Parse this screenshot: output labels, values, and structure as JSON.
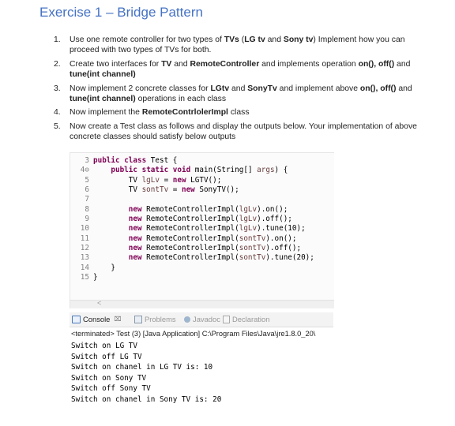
{
  "title": "Exercise 1 – Bridge Pattern",
  "tasks": [
    {
      "num": "1.",
      "parts": [
        {
          "t": "Use one remote controller for two types of "
        },
        {
          "t": "TVs",
          "b": true
        },
        {
          "t": " ("
        },
        {
          "t": "LG tv",
          "b": true
        },
        {
          "t": " and "
        },
        {
          "t": "Sony tv",
          "b": true
        },
        {
          "t": ") Implement how you can proceed with two types of TVs for both."
        }
      ]
    },
    {
      "num": "2.",
      "parts": [
        {
          "t": "Create two interfaces for "
        },
        {
          "t": "TV",
          "b": true
        },
        {
          "t": " and "
        },
        {
          "t": "RemoteController",
          "b": true
        },
        {
          "t": " and implements operation "
        },
        {
          "t": "on(), off()",
          "b": true
        },
        {
          "t": " and "
        },
        {
          "t": "tune(int channel)",
          "b": true
        }
      ]
    },
    {
      "num": "3.",
      "parts": [
        {
          "t": "Now implement 2 concrete classes for "
        },
        {
          "t": "LGtv",
          "b": true
        },
        {
          "t": " and "
        },
        {
          "t": "SonyTv",
          "b": true
        },
        {
          "t": " and implement above "
        },
        {
          "t": "on(), off()",
          "b": true
        },
        {
          "t": " and "
        },
        {
          "t": "tune(int channel)",
          "b": true
        },
        {
          "t": " operations in each class"
        }
      ]
    },
    {
      "num": "4.",
      "parts": [
        {
          "t": "Now implement the "
        },
        {
          "t": "RemoteContrlolerImpl",
          "b": true
        },
        {
          "t": " class"
        }
      ]
    },
    {
      "num": "5.",
      "parts": [
        {
          "t": "Now create a Test class as follows and display the outputs below. Your implementation of above concrete classes should satisfy below outputs"
        }
      ]
    }
  ],
  "code": {
    "lines": [
      {
        "n": "3",
        "segs": [
          {
            "t": "public",
            "k": "kw"
          },
          {
            "t": " "
          },
          {
            "t": "class",
            "k": "kw"
          },
          {
            "t": " Test {"
          }
        ]
      },
      {
        "n": "4⊖",
        "segs": [
          {
            "t": "    "
          },
          {
            "t": "public",
            "k": "kw"
          },
          {
            "t": " "
          },
          {
            "t": "static",
            "k": "kw"
          },
          {
            "t": " "
          },
          {
            "t": "void",
            "k": "kw"
          },
          {
            "t": " main(String[] "
          },
          {
            "t": "args",
            "k": "fld"
          },
          {
            "t": ") {"
          }
        ]
      },
      {
        "n": "5",
        "segs": [
          {
            "t": "        TV "
          },
          {
            "t": "lgLv",
            "k": "fld"
          },
          {
            "t": " = "
          },
          {
            "t": "new",
            "k": "kw"
          },
          {
            "t": " LGTV();"
          }
        ]
      },
      {
        "n": "6",
        "segs": [
          {
            "t": "        TV "
          },
          {
            "t": "sontTv",
            "k": "fld"
          },
          {
            "t": " = "
          },
          {
            "t": "new",
            "k": "kw"
          },
          {
            "t": " SonyTV();"
          }
        ]
      },
      {
        "n": "7",
        "segs": []
      },
      {
        "n": "8",
        "segs": [
          {
            "t": "        "
          },
          {
            "t": "new",
            "k": "kw"
          },
          {
            "t": " RemoteControllerImpl("
          },
          {
            "t": "lgLv",
            "k": "fld"
          },
          {
            "t": ").on();"
          }
        ]
      },
      {
        "n": "9",
        "segs": [
          {
            "t": "        "
          },
          {
            "t": "new",
            "k": "kw"
          },
          {
            "t": " RemoteControllerImpl("
          },
          {
            "t": "lgLv",
            "k": "fld"
          },
          {
            "t": ").off();"
          }
        ]
      },
      {
        "n": "10",
        "segs": [
          {
            "t": "        "
          },
          {
            "t": "new",
            "k": "kw"
          },
          {
            "t": " RemoteControllerImpl("
          },
          {
            "t": "lgLv",
            "k": "fld"
          },
          {
            "t": ").tune(10);"
          }
        ]
      },
      {
        "n": "11",
        "segs": [
          {
            "t": "        "
          },
          {
            "t": "new",
            "k": "kw"
          },
          {
            "t": " RemoteControllerImpl("
          },
          {
            "t": "sontTv",
            "k": "fld"
          },
          {
            "t": ").on();"
          }
        ]
      },
      {
        "n": "12",
        "segs": [
          {
            "t": "        "
          },
          {
            "t": "new",
            "k": "kw"
          },
          {
            "t": " RemoteControllerImpl("
          },
          {
            "t": "sontTv",
            "k": "fld"
          },
          {
            "t": ").off();"
          }
        ]
      },
      {
        "n": "13",
        "segs": [
          {
            "t": "        "
          },
          {
            "t": "new",
            "k": "kw"
          },
          {
            "t": " RemoteControllerImpl("
          },
          {
            "t": "sontTv",
            "k": "fld"
          },
          {
            "t": ").tune(20);"
          }
        ]
      },
      {
        "n": "14",
        "segs": [
          {
            "t": "    }"
          }
        ]
      },
      {
        "n": "15",
        "segs": [
          {
            "t": "}"
          }
        ]
      }
    ],
    "scroll_arrow": "<"
  },
  "console": {
    "tabs": [
      {
        "label": "Console",
        "icon": "console-icon",
        "active": true,
        "close": "⌧"
      },
      {
        "label": "Problems",
        "icon": "problems-icon",
        "active": false
      },
      {
        "label": "Javadoc",
        "icon": "javadoc-icon",
        "active": false
      },
      {
        "label": "Declaration",
        "icon": "declaration-icon",
        "active": false
      }
    ],
    "terminated": "<terminated> Test (3) [Java Application] C:\\Program Files\\Java\\jre1.8.0_20\\",
    "output": [
      "Switch on LG TV",
      "Switch off LG TV",
      "Switch on chanel in LG TV is: 10",
      "Switch on Sony TV",
      "Switch off Sony TV",
      "Switch on chanel in Sony TV is: 20"
    ]
  },
  "colors": {
    "title": "#4472c4",
    "keyword": "#7f0055",
    "field": "#6a3e3e",
    "line_number": "#808080"
  }
}
